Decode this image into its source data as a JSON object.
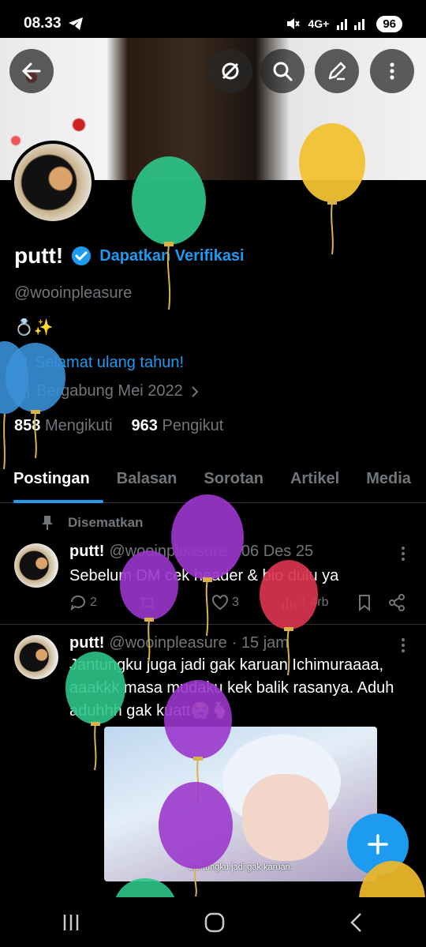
{
  "status_bar": {
    "time": "08.33",
    "network": "4G+",
    "battery": "96"
  },
  "profile": {
    "name": "putt!",
    "verify_label": "Dapatkan Verifikasi",
    "handle": "@wooinpleasure",
    "bio": "💍✨",
    "birthday": "Selamat ulang tahun!",
    "joined": "Bergabung Mei 2022",
    "following_count": "858",
    "following_label": "Mengikuti",
    "followers_count": "963",
    "followers_label": "Pengikut"
  },
  "tabs": [
    "Postingan",
    "Balasan",
    "Sorotan",
    "Artikel",
    "Media"
  ],
  "posts": [
    {
      "pinned_label": "Disematkan",
      "name": "putt!",
      "handle": "@wooinpleasure",
      "time": "· 06 Des 25",
      "text": "Sebelum DM cek header & bio dulu ya",
      "replies": "2",
      "likes": "3",
      "views": "1,4rb"
    },
    {
      "name": "putt!",
      "handle": "@wooinpleasure",
      "time": "· 15 jam",
      "text": "Jantungku juga jadi gak karuan Ichimuraaaa, aaakkk masa mudaku kek balik rasanya. Aduh aduhhh gak kuatt😭🫰🏻",
      "media_caption": "Jantungku jadi gak karuan."
    }
  ],
  "icons": {
    "back": "arrow-left-icon",
    "grok": "grok-icon",
    "search": "search-icon",
    "edit": "edit-icon",
    "more": "more-icon",
    "pin": "pin-icon",
    "compose": "plus-icon"
  },
  "colors": {
    "accent": "#1d9bf0",
    "background": "#000000",
    "muted": "#71767b"
  },
  "balloons": [
    "green",
    "yellow",
    "blue",
    "purple",
    "purple",
    "red",
    "green",
    "purple",
    "purple",
    "yellow",
    "green"
  ]
}
